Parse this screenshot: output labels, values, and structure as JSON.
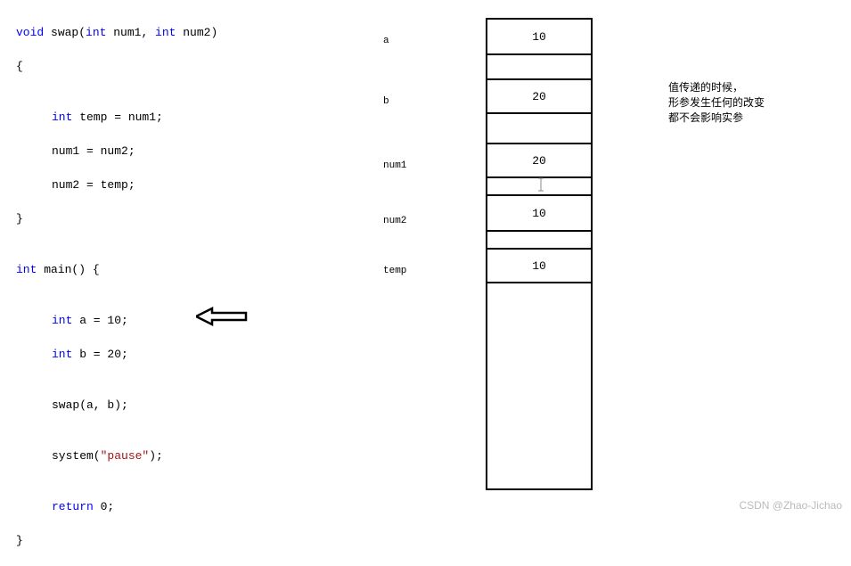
{
  "code": {
    "l1_kw": "void",
    "l1_fn": " swap(",
    "l1_p1t": "int",
    "l1_p1n": " num1, ",
    "l1_p2t": "int",
    "l1_p2n": " num2)",
    "l2": "{",
    "l3": "",
    "l4_a": "int",
    "l4_b": " temp = num1;",
    "l5": "num1 = num2;",
    "l6": "num2 = temp;",
    "l7": "}",
    "l8": "",
    "l9_a": "int",
    "l9_b": " main() {",
    "l10": "",
    "l11_a": "int",
    "l11_b": " a = 10;",
    "l12_a": "int",
    "l12_b": " b = 20;",
    "l13": "",
    "l14": "swap(a, b);",
    "l15": "",
    "l16_a": "system(",
    "l16_b": "\"pause\"",
    "l16_c": ");",
    "l17": "",
    "l18_a": "return",
    "l18_b": " 0;",
    "l19": "}"
  },
  "labels": {
    "a": "a",
    "b": "b",
    "num1": "num1",
    "num2": "num2",
    "temp": "temp"
  },
  "memory": {
    "a": "10",
    "b": "20",
    "num1": "20",
    "num2": "10",
    "temp": "10"
  },
  "note": {
    "l1": "值传递的时候，",
    "l2": "形参发生任何的改变",
    "l3": "都不会影响实参"
  },
  "watermark": "CSDN @Zhao-Jichao"
}
